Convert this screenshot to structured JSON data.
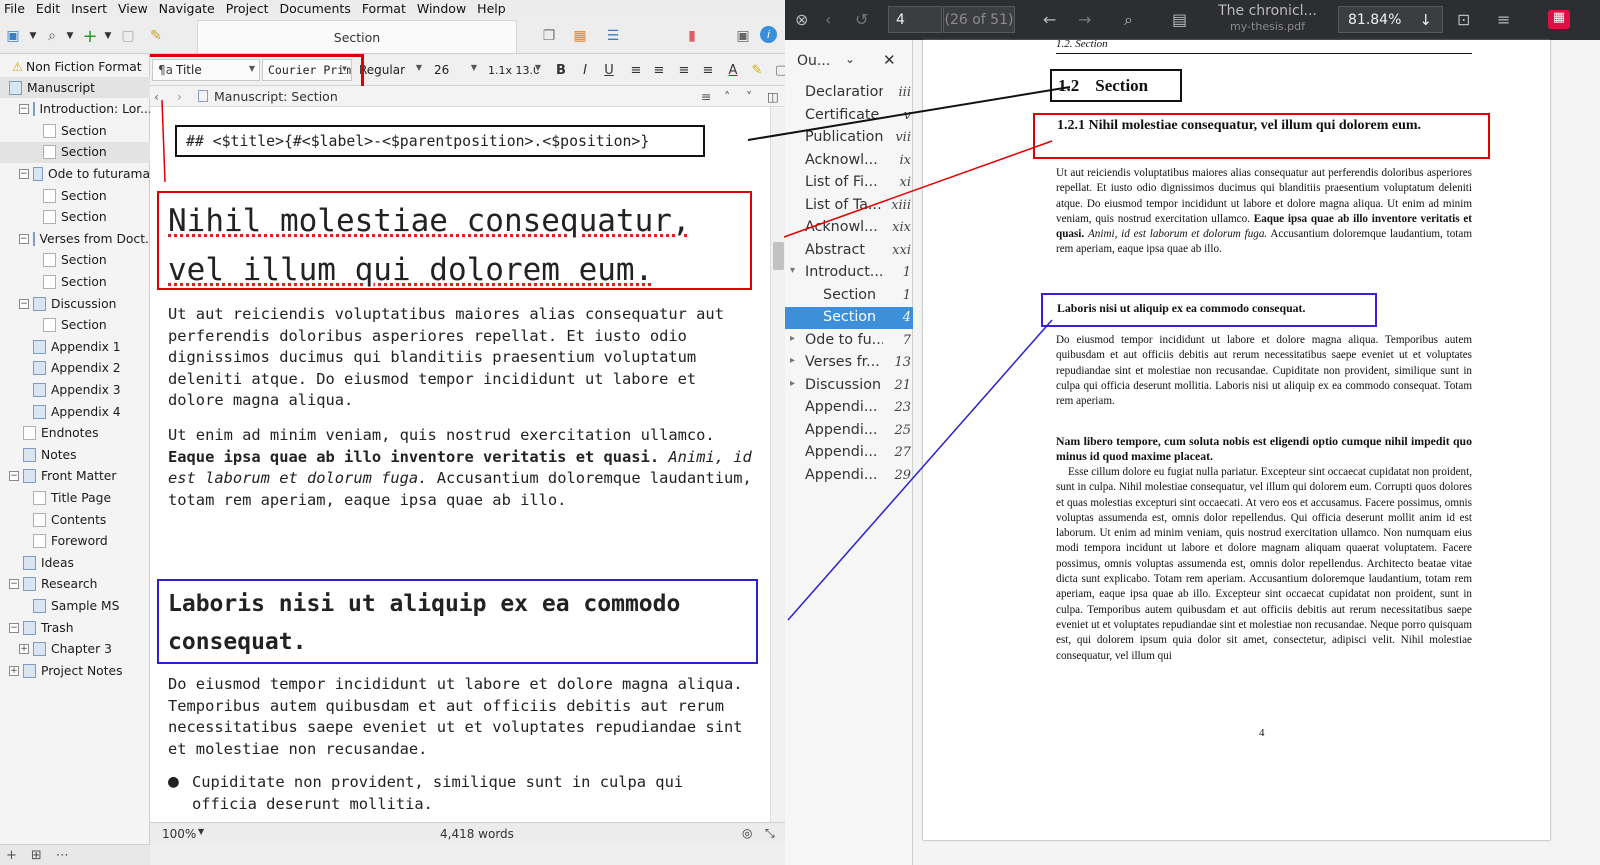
{
  "menubar": [
    "File",
    "Edit",
    "Insert",
    "View",
    "Navigate",
    "Project",
    "Documents",
    "Format",
    "Window",
    "Help"
  ],
  "doc_tab_title": "Section",
  "format_bar": {
    "style": "Title",
    "font_family": "Courier Prime",
    "font_weight": "Regular",
    "font_size": "26",
    "line_spacing": "1.1x 13.0",
    "bold": "B",
    "italic": "I",
    "underline": "U"
  },
  "binder": {
    "root": "Non Fiction Format",
    "items": [
      {
        "label": "Manuscript",
        "level": 0,
        "selected": true
      },
      {
        "label": "Introduction: Lor...",
        "level": 1
      },
      {
        "label": "Section",
        "level": 2
      },
      {
        "label": "Section",
        "level": 2,
        "selected": true
      },
      {
        "label": "Ode to futurama",
        "level": 1
      },
      {
        "label": "Section",
        "level": 2
      },
      {
        "label": "Section",
        "level": 2
      },
      {
        "label": "Verses from Doct...",
        "level": 1
      },
      {
        "label": "Section",
        "level": 2
      },
      {
        "label": "Section",
        "level": 2
      },
      {
        "label": "Discussion",
        "level": 1
      },
      {
        "label": "Section",
        "level": 2
      },
      {
        "label": "Appendix 1",
        "level": 1
      },
      {
        "label": "Appendix 2",
        "level": 1
      },
      {
        "label": "Appendix 3",
        "level": 1
      },
      {
        "label": "Appendix 4",
        "level": 1
      },
      {
        "label": "Endnotes",
        "level": 0
      },
      {
        "label": "Notes",
        "level": 0
      },
      {
        "label": "Front Matter",
        "level": 0
      },
      {
        "label": "Title Page",
        "level": 1
      },
      {
        "label": "Contents",
        "level": 1
      },
      {
        "label": "Foreword",
        "level": 1
      },
      {
        "label": "Ideas",
        "level": 0
      },
      {
        "label": "Research",
        "level": 0
      },
      {
        "label": "Sample MS",
        "level": 1
      },
      {
        "label": "Trash",
        "level": 0
      },
      {
        "label": "Chapter 3",
        "level": 1
      },
      {
        "label": "Project Notes",
        "level": 0
      }
    ]
  },
  "editor": {
    "path": "Manuscript: Section",
    "code_line": "## <$title>{#<$label>-<$parentposition>.<$position>}",
    "title": "Nihil molestiae consequatur, vel illum qui dolorem eum.",
    "para1": "Ut aut reiciendis voluptatibus maiores alias consequatur aut perferendis doloribus asperiores repellat. Et iusto odio dignissimos ducimus qui blanditiis praesentium voluptatum deleniti atque. Do eiusmod tempor incididunt ut labore et dolore magna aliqua.",
    "para2_a": "Ut enim ad minim veniam, quis nostrud exercitation ullamco.",
    "para2_bold": "Eaque ipsa quae ab illo inventore veritatis et quasi.",
    "para2_italic": "Animi, id est laborum et dolorum fuga.",
    "para2_b": "Accusantium doloremque laudantium, totam rem aperiam, eaque ipsa quae ab illo.",
    "subheading": "Laboris nisi ut aliquip ex ea commodo consequat.",
    "para3": "Do eiusmod tempor incididunt ut labore et dolore magna aliqua. Temporibus autem quibusdam et aut officiis debitis aut rerum necessitatibus saepe eveniet ut et voluptates repudiandae sint et molestiae non recusandae.",
    "bullet1": "Cupiditate non provident, similique sunt in culpa qui officia deserunt mollitia."
  },
  "status": {
    "zoom": "100%",
    "words": "4,418 words"
  },
  "pdf": {
    "page_input": "4",
    "page_of": "(26 of 51)",
    "doc_title": "The chronicl...",
    "file_name": "my-thesis.pdf",
    "zoom": "81.84%",
    "outline_label": "Ou...",
    "outline": [
      {
        "t": "Declaration",
        "p": "iii",
        "lvl": 0
      },
      {
        "t": "Certificate",
        "p": "v",
        "lvl": 0
      },
      {
        "t": "Publication",
        "p": "vii",
        "lvl": 0
      },
      {
        "t": "Acknowl...",
        "p": "ix",
        "lvl": 0
      },
      {
        "t": "List of Fi...",
        "p": "xi",
        "lvl": 0
      },
      {
        "t": "List of Ta...",
        "p": "xiii",
        "lvl": 0
      },
      {
        "t": "Acknowl...",
        "p": "xix",
        "lvl": 0
      },
      {
        "t": "Abstract",
        "p": "xxi",
        "lvl": 0
      },
      {
        "t": "Introduct...",
        "p": "1",
        "lvl": 0,
        "open": true
      },
      {
        "t": "Section",
        "p": "1",
        "lvl": 1
      },
      {
        "t": "Section",
        "p": "4",
        "lvl": 1,
        "sel": true
      },
      {
        "t": "Ode to fu...",
        "p": "7",
        "lvl": 0,
        "arrow": true
      },
      {
        "t": "Verses fr...",
        "p": "13",
        "lvl": 0,
        "arrow": true
      },
      {
        "t": "Discussion",
        "p": "21",
        "lvl": 0,
        "arrow": true
      },
      {
        "t": "Appendi...",
        "p": "23",
        "lvl": 0
      },
      {
        "t": "Appendi...",
        "p": "25",
        "lvl": 0
      },
      {
        "t": "Appendi...",
        "p": "27",
        "lvl": 0
      },
      {
        "t": "Appendi...",
        "p": "29",
        "lvl": 0
      }
    ],
    "running_head": "1.2. Section",
    "sec_num": "1.2",
    "sec_title": "Section",
    "subsec": "1.2.1  Nihil molestiae consequatur, vel illum qui dolorem eum.",
    "p1": "Ut aut reiciendis voluptatibus maiores alias consequatur aut perferendis doloribus asperiores repellat. Et iusto odio dignissimos ducimus qui blanditiis praesentium voluptatum deleniti atque. Do eiusmod tempor incididunt ut labore et dolore magna aliqua. Ut enim ad minim veniam, quis nostrud exercitation ullamco.",
    "p1_bold": "Eaque ipsa quae ab illo inventore veritatis et quasi.",
    "p1_italic": "Animi, id est laborum et dolorum fuga.",
    "p1_end": "Accusantium doloremque laudantium, totam rem aperiam, eaque ipsa quae ab illo.",
    "para_head": "Laboris nisi ut aliquip ex ea commodo consequat.",
    "p2": "Do eiusmod tempor incididunt ut labore et dolore magna aliqua. Temporibus autem quibusdam et aut officiis debitis aut rerum necessitatibus saepe eveniet ut et voluptates repudiandae sint et molestiae non recusandae. Cupiditate non provident, similique sunt in culpa qui officia deserunt mollitia. Laboris nisi ut aliquip ex ea commodo consequat. Totam rem aperiam.",
    "p3_bold": "Nam libero tempore, cum soluta nobis est eligendi optio cumque nihil impedit quo minus id quod maxime placeat.",
    "p3": "Esse cillum dolore eu fugiat nulla pariatur. Excepteur sint occaecat cupidatat non proident, sunt in culpa. Nihil molestiae consequatur, vel illum qui dolorem eum. Corrupti quos dolores et quas molestias excepturi sint occaecati. At vero eos et accusamus. Facere possimus, omnis voluptas assumenda est, omnis dolor repellendus. Qui officia deserunt mollit anim id est laborum. Ut enim ad minim veniam, quis nostrud exercitation ullamco. Non numquam eius modi tempora incidunt ut labore et dolore magnam aliquam quaerat voluptatem. Facere possimus, omnis voluptas assumenda est, omnis dolor repellendus. Architecto beatae vitae dicta sunt explicabo. Totam rem aperiam. Accusantium doloremque laudantium, totam rem aperiam, eaque ipsa quae ab illo. Excepteur sint occaecat cupidatat non proident, sunt in culpa. Temporibus autem quibusdam et aut officiis debitis aut rerum necessitatibus saepe eveniet ut et voluptates repudiandae sint et molestiae non recusandae. Neque porro quisquam est, qui dolorem ipsum quia dolor sit amet, consectetur, adipisci velit. Nihil molestiae consequatur, vel illum qui",
    "page_number": "4"
  }
}
